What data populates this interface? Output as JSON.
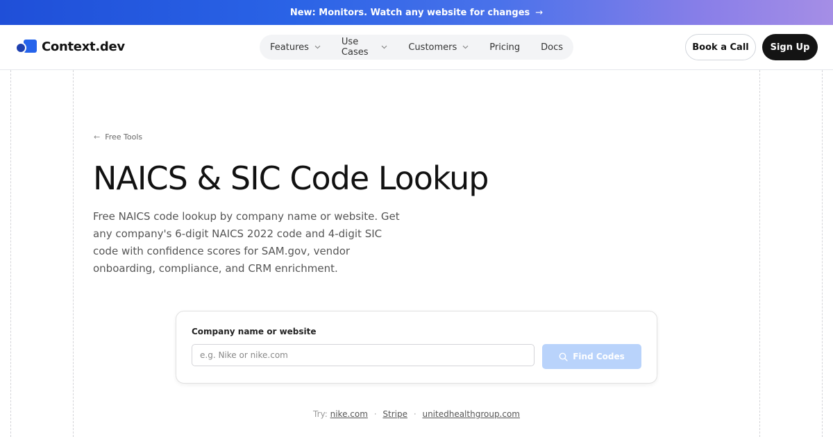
{
  "banner": {
    "text": "New: Monitors. Watch any website for changes",
    "arrow": "→"
  },
  "header": {
    "logo_text": "Context.dev",
    "nav": [
      {
        "label": "Features",
        "has_dropdown": true
      },
      {
        "label": "Use Cases",
        "has_dropdown": true
      },
      {
        "label": "Customers",
        "has_dropdown": true
      },
      {
        "label": "Pricing",
        "has_dropdown": false
      },
      {
        "label": "Docs",
        "has_dropdown": false
      }
    ],
    "book_call": "Book a Call",
    "sign_up": "Sign Up"
  },
  "breadcrumb": {
    "arrow": "←",
    "label": "Free Tools"
  },
  "page": {
    "title": "NAICS & SIC Code Lookup",
    "description": "Free NAICS code lookup by company name or website. Get any company's 6-digit NAICS 2022 code and 4-digit SIC code with confidence scores for SAM.gov, vendor onboarding, compliance, and CRM enrichment."
  },
  "search": {
    "label": "Company name or website",
    "placeholder": "e.g. Nike or nike.com",
    "value": "",
    "button": "Find Codes"
  },
  "try": {
    "prefix": "Try:",
    "sep": "·",
    "links": [
      "nike.com",
      "Stripe",
      "unitedhealthgroup.com"
    ]
  },
  "colors": {
    "accent": "#2563eb",
    "button_disabled": "#b9d3fb",
    "dark": "#141414"
  },
  "icons": {
    "dropdown": "chevron-down-icon",
    "search": "search-icon",
    "back": "arrow-left-icon"
  }
}
